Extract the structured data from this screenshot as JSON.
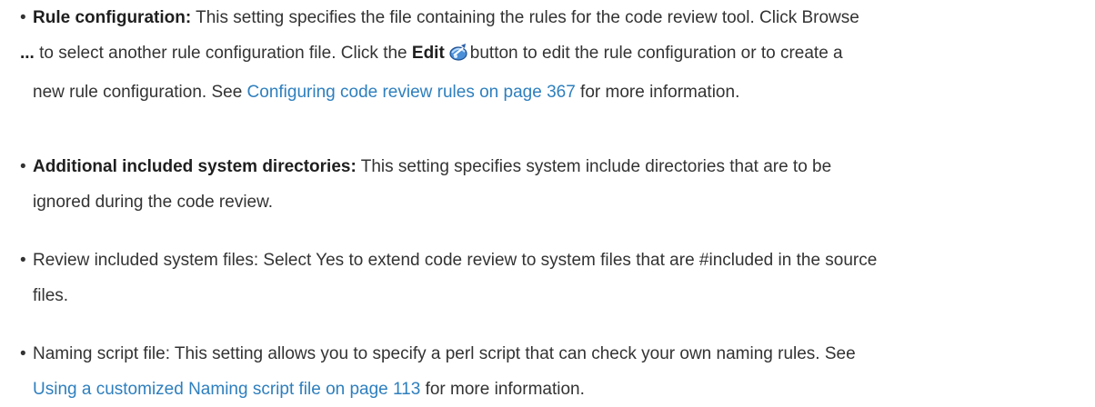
{
  "items": [
    {
      "bullet": "•",
      "term": "Rule configuration:",
      "line1": " This setting specifies the file containing the rules for the code review tool. Click Browse",
      "dots": "...",
      "line2a": " to select another rule configuration file. Click the ",
      "edit_label": "Edit",
      "line2b": "button to edit the rule configuration or to create a",
      "line3a": "new rule configuration. See ",
      "link": "Configuring code review rules on page 367",
      "line3b": " for more information."
    },
    {
      "bullet": "•",
      "term": "Additional included system directories:",
      "line1": " This setting specifies system include directories that are to be",
      "line2": "ignored during the code review."
    },
    {
      "bullet": "•",
      "line1": "Review included system files: Select Yes to extend code review to system files that are #included in the source",
      "line2": "files."
    },
    {
      "bullet": "•",
      "line1": "Naming script file: This setting allows you to specify a perl script that can check your own naming rules. See",
      "link": "Using a customized Naming script file on page 113",
      "line2b": " for more information."
    }
  ],
  "icons": {
    "edit": "edit-icon"
  },
  "colors": {
    "link": "#2e7fbe",
    "text": "#333333"
  }
}
